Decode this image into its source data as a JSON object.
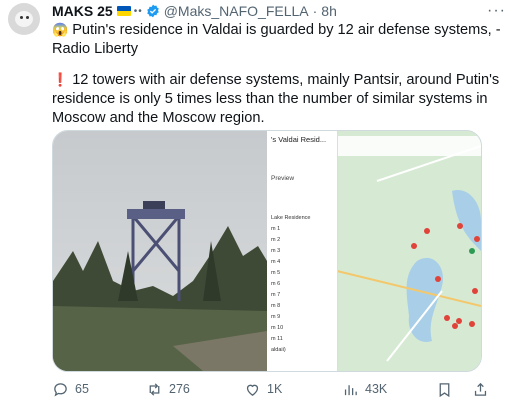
{
  "tweet": {
    "author_name": "MAKS 25",
    "author_handle": "@Maks_NAFO_FELLA",
    "separator": "·",
    "time": "8h",
    "flag_icon": "ukraine-flag-icon",
    "more_label": "···",
    "paragraph1": "Putin's residence in Valdai is guarded by 12 air defense systems, - Radio Liberty",
    "paragraph2": "12 towers with air defense systems, mainly Pantsir, around Putin's residence is only 5 times less than the number of similar systems in Moscow and the Moscow region.",
    "emoji1": "😱",
    "emoji2": "❗"
  },
  "map_panel": {
    "title": "'s Valdai Resid...",
    "preview": "Preview",
    "list": [
      "Lake Residence",
      "m 1",
      "m 2",
      "m 3",
      "m 4",
      "m 5",
      "m 6",
      "m 7",
      "m 8",
      "m 9",
      "m 10",
      "m 11",
      "aldaii)"
    ]
  },
  "actions": {
    "replies": "65",
    "reposts": "276",
    "likes": "1K",
    "views": "43K"
  },
  "colors": {
    "muted": "#536471",
    "verified": "#1d9bf0",
    "text": "#0f1419"
  }
}
